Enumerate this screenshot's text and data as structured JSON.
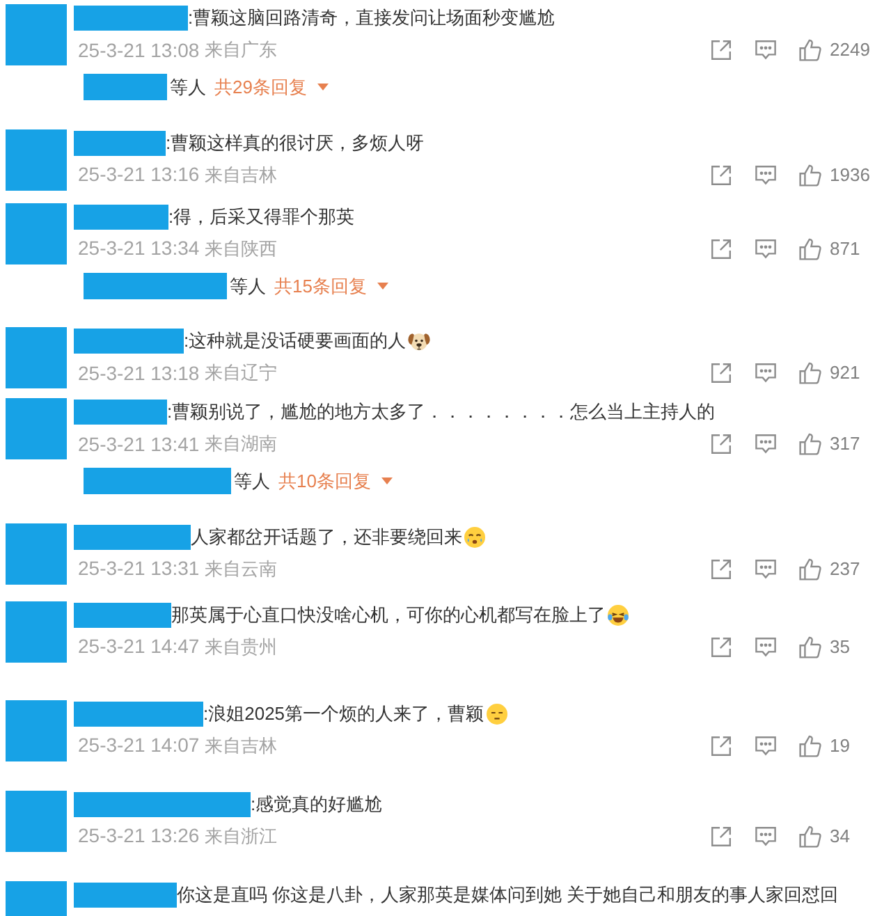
{
  "comments": [
    {
      "text": ":曹颖这脑回路清奇，直接发问让场面秒变尴尬",
      "time": "25-3-21 13:08",
      "location": "来自广东",
      "likes": "2249",
      "replies": {
        "suffix": "等人",
        "count": "共29条回复",
        "expanded": false
      }
    },
    {
      "text": ":曹颖这样真的很讨厌，多烦人呀",
      "time": "25-3-21 13:16",
      "location": "来自吉林",
      "likes": "1936"
    },
    {
      "text": ":得，后采又得罪个那英",
      "time": "25-3-21 13:34",
      "location": "来自陕西",
      "likes": "871",
      "replies": {
        "suffix": "等人",
        "count": "共15条回复",
        "expanded": false
      }
    },
    {
      "text": ":这种就是没话硬要画面的人",
      "emoji": {
        "kind": "dog"
      },
      "time": "25-3-21 13:18",
      "location": "来自辽宁",
      "likes": "921"
    },
    {
      "text": ":曹颖别说了，尴尬的地方太多了．．．．．．．．怎么当上主持人的",
      "time": "25-3-21 13:41",
      "location": "来自湖南",
      "likes": "317",
      "replies": {
        "suffix": "等人",
        "count": "共10条回复",
        "expanded": false
      }
    },
    {
      "text": "人家都岔开话题了，还非要绕回来",
      "emoji": {
        "kind": "crying"
      },
      "time": "25-3-21 13:31",
      "location": "来自云南",
      "likes": "237"
    },
    {
      "text": "那英属于心直口快没啥心机，可你的心机都写在脸上了",
      "emoji": {
        "kind": "laughing"
      },
      "time": "25-3-21 14:47",
      "location": "来自贵州",
      "likes": "35"
    },
    {
      "text": ":浪姐2025第一个烦的人来了，曹颖",
      "emoji": {
        "kind": "expressionless"
      },
      "time": "25-3-21 14:07",
      "location": "来自吉林",
      "likes": "19"
    },
    {
      "text": ":感觉真的好尴尬",
      "time": "25-3-21 13:26",
      "location": "来自浙江",
      "likes": "34"
    },
    {
      "text": "你这是直吗 你这是八卦，人家那英是媒体问到她 关于她自己和朋友的事人家回怼回"
    }
  ]
}
